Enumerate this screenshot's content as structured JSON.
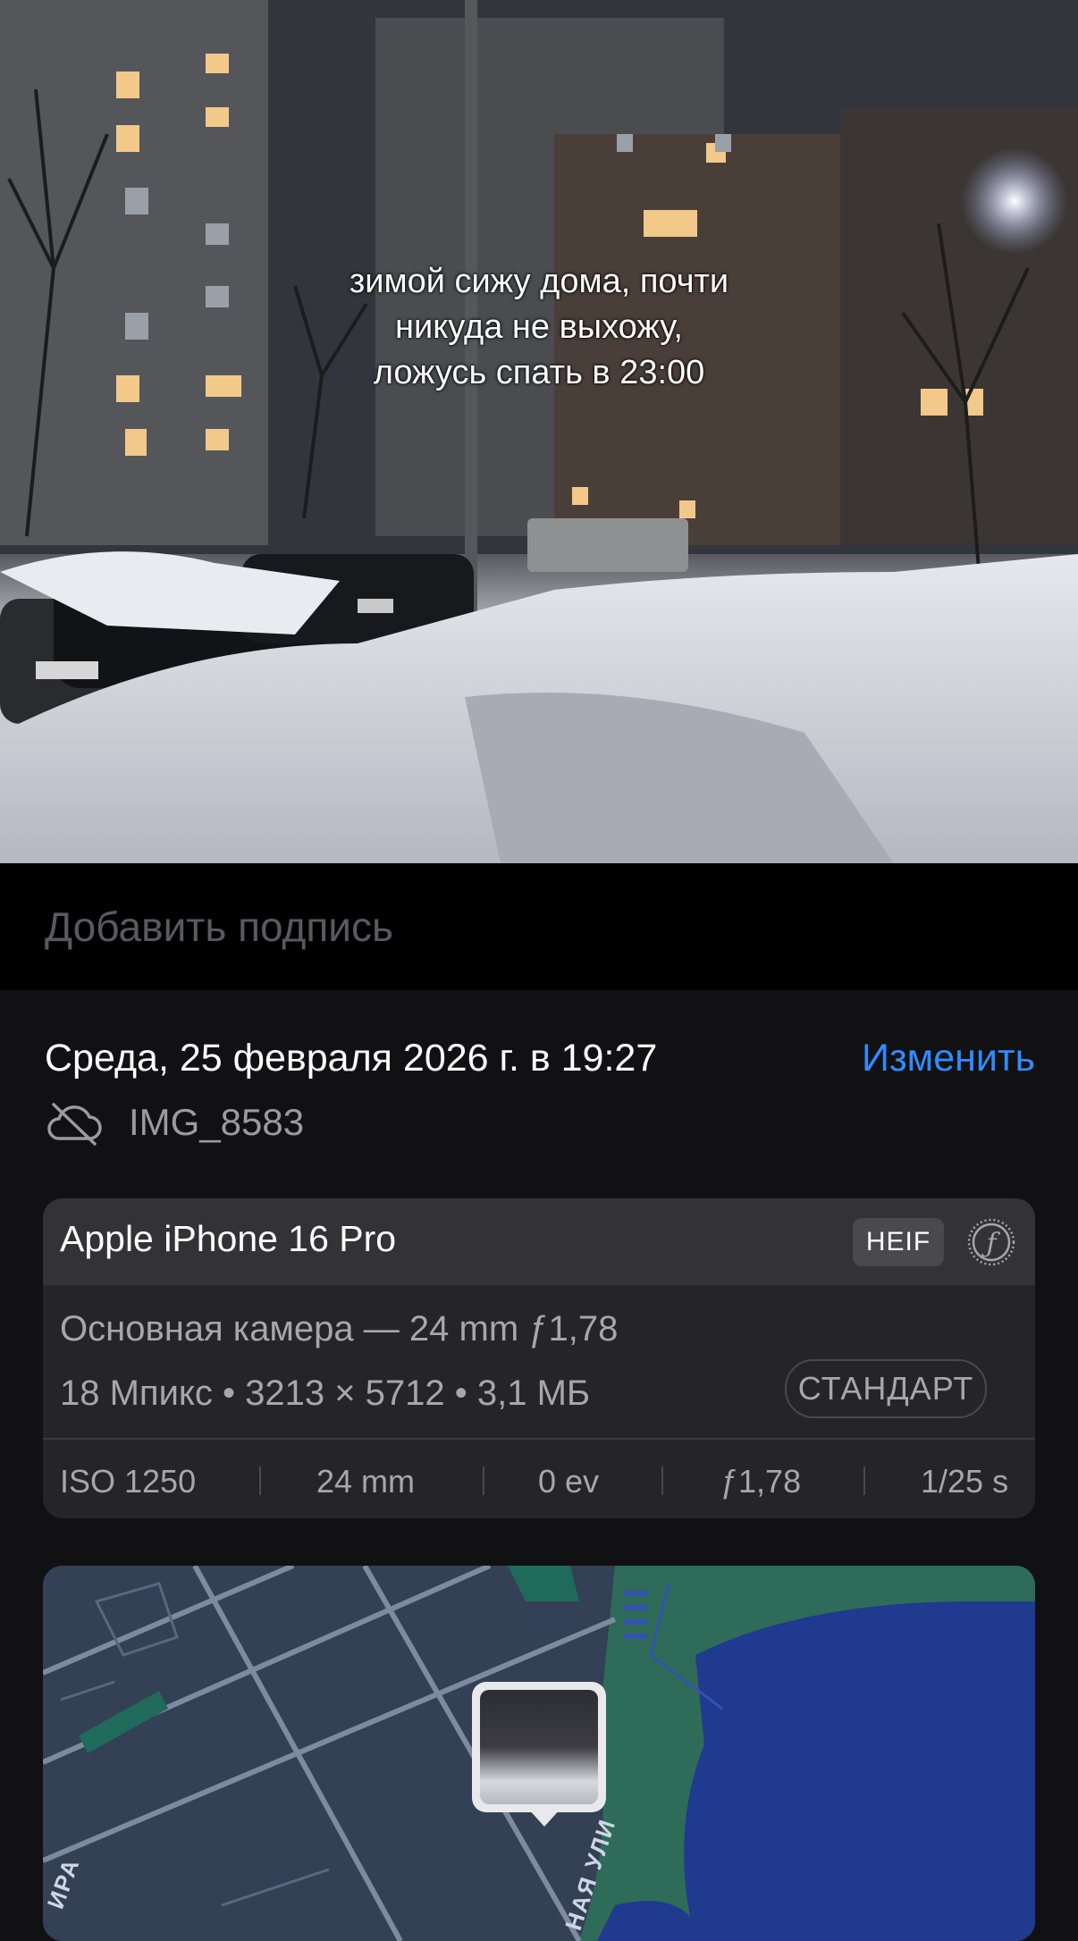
{
  "photo": {
    "overlay_lines": [
      "зимой сижу дома, почти",
      "никуда не выхожу,",
      "ложусь спать в 23:00"
    ]
  },
  "caption": {
    "placeholder": "Добавить подпись"
  },
  "meta": {
    "date": "Среда, 25 февраля 2026 г. в 19:27",
    "edit_label": "Изменить",
    "filename": "IMG_8583",
    "cloud_icon": "cloud-slash-icon"
  },
  "camera": {
    "device": "Apple iPhone 16 Pro",
    "format_badge": "HEIF",
    "aperture_icon": "aperture-f-icon",
    "lens": "Основная камера — 24 mm ƒ1,78",
    "specs": "18 Мпикс • 3213 × 5712 • 3,1 МБ",
    "style_badge": "СТАНДАРТ",
    "exif": [
      "ISO 1250",
      "24 mm",
      "0 ev",
      "ƒ1,78",
      "1/25 s"
    ]
  },
  "map": {
    "labels": [
      "ИРА",
      "НАЯ УЛИ"
    ]
  },
  "colors": {
    "accent": "#2f8cff",
    "background": "#111114",
    "card": "#252528",
    "water": "#1f3a8f",
    "park": "#2f6b59"
  }
}
